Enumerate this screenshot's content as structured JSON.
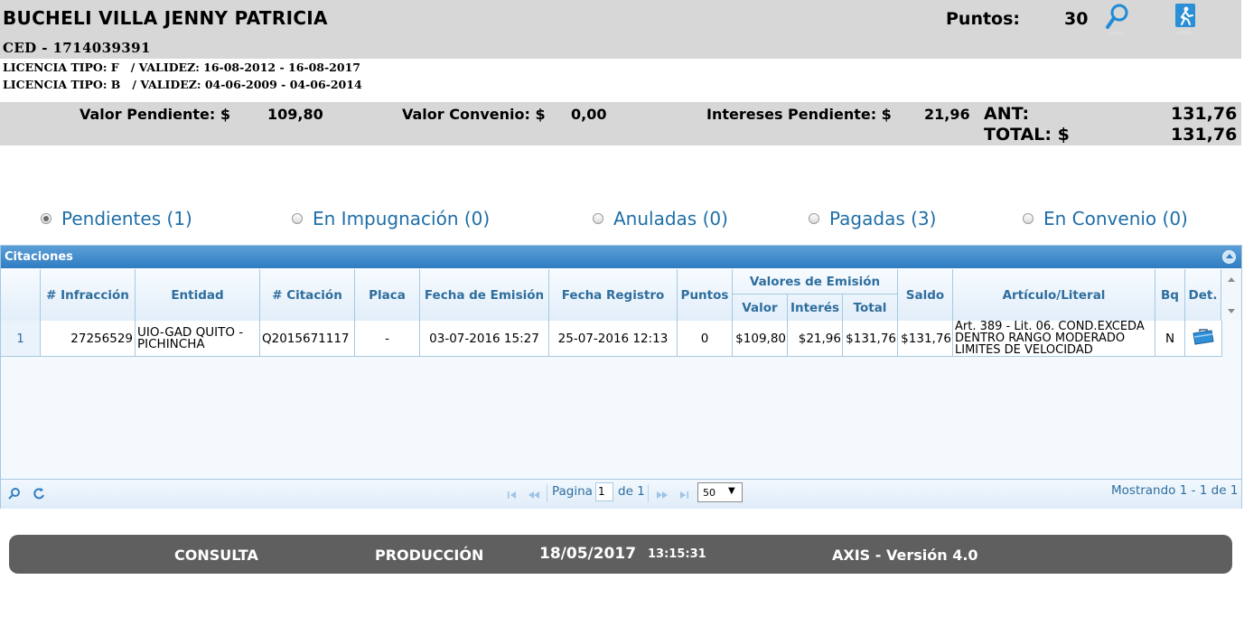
{
  "header": {
    "name": "BUCHELI VILLA JENNY PATRICIA",
    "ced": "CED - 1714039391",
    "points_label": "Puntos:",
    "points_value": "30",
    "licenses": [
      "LICENCIA TIPO: F   / VALIDEZ: 16-08-2012 - 16-08-2017",
      "LICENCIA TIPO: B   / VALIDEZ: 04-06-2009 - 04-06-2014"
    ]
  },
  "totals": {
    "pendiente_label": "Valor Pendiente: $",
    "pendiente_value": "109,80",
    "convenio_label": "Valor Convenio: $",
    "convenio_value": "0,00",
    "intereses_label": "Intereses Pendiente: $",
    "intereses_value": "21,96",
    "ant_label": "ANT:",
    "ant_value": "131,76",
    "total_label": "TOTAL: $",
    "total_value": "131,76"
  },
  "filters": [
    {
      "label": "Pendientes (1)",
      "selected": true
    },
    {
      "label": "En Impugnación (0)",
      "selected": false
    },
    {
      "label": "Anuladas (0)",
      "selected": false
    },
    {
      "label": "Pagadas (3)",
      "selected": false
    },
    {
      "label": "En Convenio (0)",
      "selected": false
    }
  ],
  "grid": {
    "caption": "Citaciones",
    "headers": {
      "infraccion": "# Infracción",
      "entidad": "Entidad",
      "citacion": "# Citación",
      "placa": "Placa",
      "fecha_emision": "Fecha de Emisión",
      "fecha_registro": "Fecha Registro",
      "puntos": "Puntos",
      "valores_group": "Valores de Emisión",
      "valor": "Valor",
      "interes": "Interés",
      "total": "Total",
      "saldo": "Saldo",
      "articulo": "Artículo/Literal",
      "bq": "Bq",
      "det": "Det."
    },
    "rows": [
      {
        "num": "1",
        "infraccion": "27256529",
        "entidad": "UIO-GAD QUITO - PICHINCHA",
        "citacion": "Q2015671117",
        "placa": "-",
        "fecha_emision": "03-07-2016 15:27",
        "fecha_registro": "25-07-2016 12:13",
        "puntos": "0",
        "valor": "$109,80",
        "interes": "$21,96",
        "total": "$131,76",
        "saldo": "$131,76",
        "articulo": "Art. 389 - Lit. 06. COND.EXCEDA DENTRO RANGO MODERADO LIMITES DE VELOCIDAD",
        "bq": "N",
        "det_icon": "toolbox-icon"
      }
    ],
    "pager": {
      "page_label": "Pagina",
      "page_value": "1",
      "of_label": "de 1",
      "page_size": "50",
      "summary": "Mostrando 1 - 1 de 1"
    }
  },
  "footer": {
    "mode": "CONSULTA",
    "env": "PRODUCCIÓN",
    "date": "18/05/2017",
    "time": "13:15:31",
    "version": "AXIS - Versión 4.0"
  },
  "colors": {
    "accent": "#1e6ea7",
    "header_bg": "#d7d7d7",
    "grid_header_text": "#2e6e9e",
    "footer_bg": "#5f5f5f"
  }
}
